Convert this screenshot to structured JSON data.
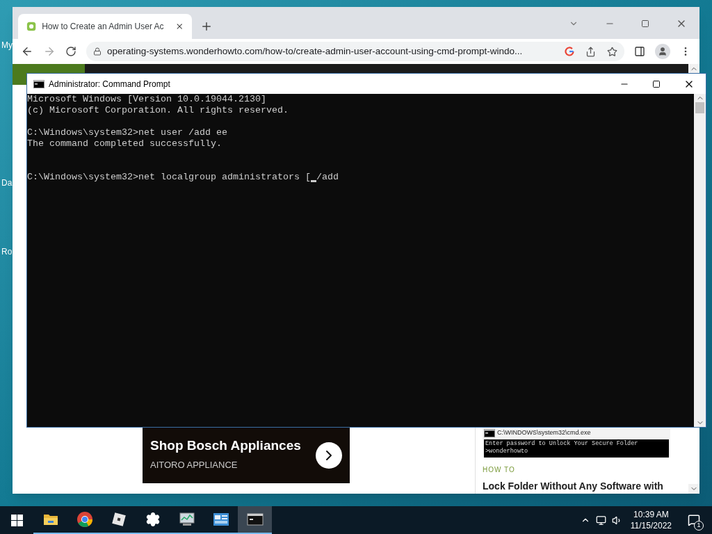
{
  "desktop": {
    "icon_labels": [
      "My",
      "Da",
      "Ro"
    ]
  },
  "browser": {
    "tab": {
      "title": "How to Create an Admin User Ac",
      "selected": true
    },
    "url": "operating-systems.wonderhowto.com/how-to/create-admin-user-account-using-cmd-prompt-windo...",
    "page": {
      "ad": {
        "title": "Shop Bosch Appliances",
        "advertiser": "AITORO APPLIANCE"
      },
      "sidebar_thumbnail": {
        "window_title": "C:\\WINDOWS\\system32\\cmd.exe",
        "lines": [
          "Enter password to Unlock Your Secure Folder",
          ">wonderhowto"
        ]
      },
      "article": {
        "category": "HOW TO",
        "title": "Lock Folder Without Any Software with"
      }
    }
  },
  "console": {
    "title": "Administrator: Command Prompt",
    "output": "Microsoft Windows [Version 10.0.19044.2130]\n(c) Microsoft Corporation. All rights reserved.\n\nC:\\Windows\\system32>net user /add ee\nThe command completed successfully.",
    "prompt": {
      "before_cursor": "C:\\Windows\\system32>net localgroup administrators [",
      "after_cursor": "/add"
    }
  },
  "taskbar": {
    "apps": [
      {
        "kind": "folder",
        "selected": false
      },
      {
        "kind": "chrome",
        "selected": false
      },
      {
        "kind": "roblox",
        "selected": false
      },
      {
        "kind": "settings",
        "selected": false
      },
      {
        "kind": "monitor",
        "selected": false
      },
      {
        "kind": "panel",
        "selected": false
      },
      {
        "kind": "console",
        "selected": true
      }
    ],
    "time": "10:39 AM",
    "date": "11/15/2022",
    "notifications": "1"
  }
}
